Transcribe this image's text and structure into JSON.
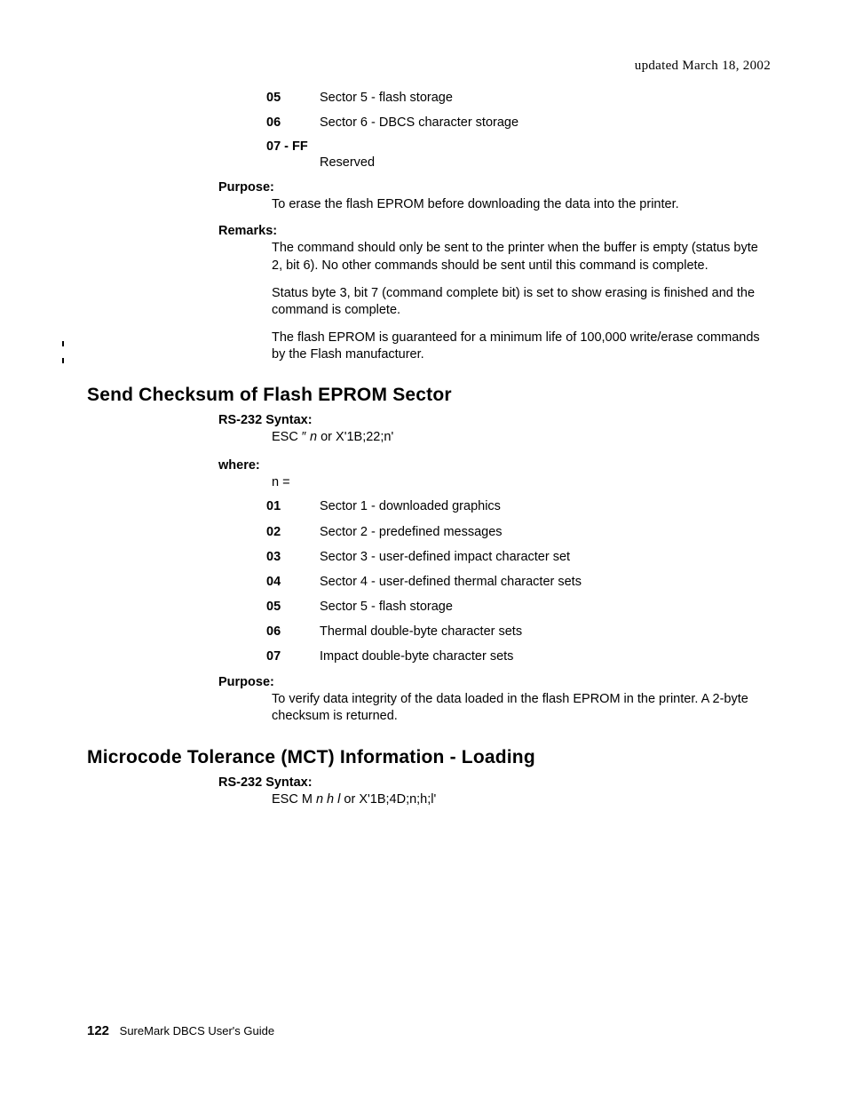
{
  "header": {
    "updated": "updated March 18, 2002"
  },
  "top_list": [
    {
      "key": "05",
      "val": "Sector 5 - flash storage"
    },
    {
      "key": "06",
      "val": "Sector 6 - DBCS character storage"
    },
    {
      "key": "07 - FF",
      "val": "Reserved",
      "stack": true
    }
  ],
  "top_purpose": {
    "label": "Purpose:",
    "body": "To erase the flash EPROM before downloading the data into the printer."
  },
  "top_remarks": {
    "label": "Remarks:",
    "p1": "The command should only be sent to the printer when the buffer is empty (status byte 2, bit 6). No other commands should be sent until this command is complete.",
    "p2": "Status byte 3, bit 7 (command complete bit) is set to show erasing is finished and the command is complete.",
    "p3": "The flash EPROM is guaranteed for a minimum life of 100,000 write/erase commands by the Flash manufacturer."
  },
  "section1": {
    "title": "Send Checksum of Flash EPROM Sector",
    "syntax_label": "RS-232 Syntax:",
    "syntax_pre": "ESC ″ ",
    "syntax_it": "n",
    "syntax_post": " or X'1B;22;n'",
    "where_label": "where:",
    "n_equals": "n =",
    "list": [
      {
        "key": "01",
        "val": "Sector 1 - downloaded graphics"
      },
      {
        "key": "02",
        "val": "Sector 2 - predefined messages"
      },
      {
        "key": "03",
        "val": "Sector 3 - user-defined impact character set"
      },
      {
        "key": "04",
        "val": "Sector 4 - user-defined thermal character sets"
      },
      {
        "key": "05",
        "val": "Sector 5 - flash storage"
      },
      {
        "key": "06",
        "val": "Thermal double-byte character sets"
      },
      {
        "key": "07",
        "val": "Impact double-byte character sets"
      }
    ],
    "purpose_label": "Purpose:",
    "purpose_body": "To verify data integrity of the data loaded in the flash EPROM in the printer. A 2-byte checksum is returned."
  },
  "section2": {
    "title": "Microcode Tolerance (MCT) Information - Loading",
    "syntax_label": "RS-232 Syntax:",
    "syntax_pre": "ESC M ",
    "syntax_it": "n h l",
    "syntax_post": " or X'1B;4D;n;h;l'"
  },
  "footer": {
    "page_num": "122",
    "doc_title": "SureMark DBCS User's Guide"
  }
}
